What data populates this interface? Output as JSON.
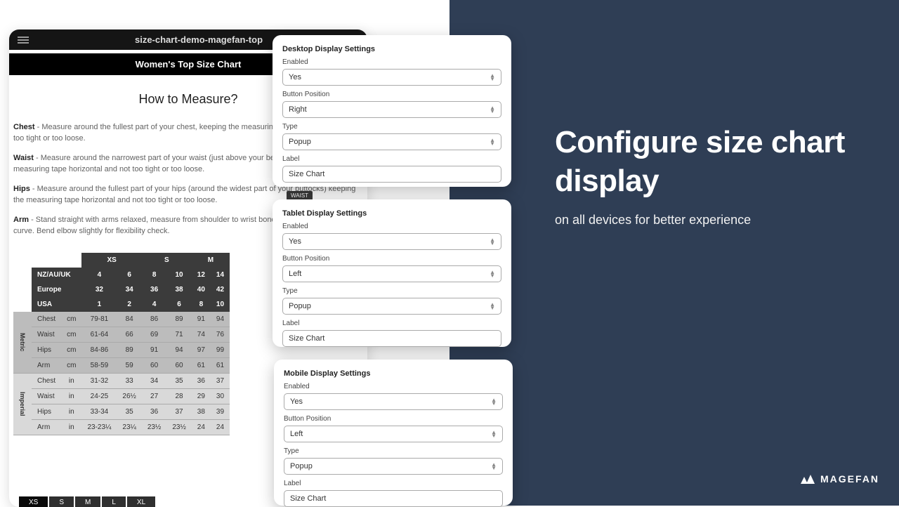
{
  "promo": {
    "headline": "Configure size chart display",
    "sub": "on all devices for better experience"
  },
  "brand": {
    "name": "MAGEFAN"
  },
  "article": {
    "url": "size-chart-demo-magefan-top",
    "title": "Women's Top Size Chart",
    "heading": "How to Measure?",
    "measures": [
      {
        "term": "Chest",
        "text": " - Measure around the fullest part of your chest, keeping the measuring tape horizontal and not too tight or too loose."
      },
      {
        "term": "Waist",
        "text": " - Measure around the narrowest part of your waist (just above your belly button) keeping the measuring tape horizontal and not too tight or too loose."
      },
      {
        "term": "Hips",
        "text": " - Measure around the fullest part of your hips (around the widest part of your buttocks) keeping the measuring tape horizontal and not too tight or too loose."
      },
      {
        "term": "Arm",
        "text": " - Stand straight with arms relaxed, measure from shoulder to wrist bone along arm's natural curve. Bend elbow slightly for flexibility check."
      }
    ],
    "waist_tag": "WAIST",
    "sizes_header": [
      "XS",
      "S",
      "M"
    ],
    "region_rows": [
      {
        "label": "NZ/AU/UK",
        "vals": [
          "4",
          "6",
          "8",
          "10",
          "12",
          "14"
        ]
      },
      {
        "label": "Europe",
        "vals": [
          "32",
          "34",
          "36",
          "38",
          "40",
          "42"
        ]
      },
      {
        "label": "USA",
        "vals": [
          "1",
          "2",
          "4",
          "6",
          "8",
          "10"
        ]
      }
    ],
    "metric_rows": [
      {
        "label": "Chest",
        "unit": "cm",
        "vals": [
          "79-81",
          "84",
          "86",
          "89",
          "91",
          "94"
        ]
      },
      {
        "label": "Waist",
        "unit": "cm",
        "vals": [
          "61-64",
          "66",
          "69",
          "71",
          "74",
          "76"
        ]
      },
      {
        "label": "Hips",
        "unit": "cm",
        "vals": [
          "84-86",
          "89",
          "91",
          "94",
          "97",
          "99"
        ]
      },
      {
        "label": "Arm",
        "unit": "cm",
        "vals": [
          "58-59",
          "59",
          "60",
          "60",
          "61",
          "61"
        ]
      }
    ],
    "imperial_rows": [
      {
        "label": "Chest",
        "unit": "in",
        "vals": [
          "31-32",
          "33",
          "34",
          "35",
          "36",
          "37"
        ]
      },
      {
        "label": "Waist",
        "unit": "in",
        "vals": [
          "24-25",
          "26½",
          "27",
          "28",
          "29",
          "30"
        ]
      },
      {
        "label": "Hips",
        "unit": "in",
        "vals": [
          "33-34",
          "35",
          "36",
          "37",
          "38",
          "39"
        ]
      },
      {
        "label": "Arm",
        "unit": "in",
        "vals": [
          "23-23¼",
          "23¼",
          "23½",
          "23½",
          "24",
          "24"
        ]
      }
    ],
    "side_labels": {
      "metric": "Metric",
      "imperial": "Imperial"
    },
    "bottom_sizes": [
      "XS",
      "S",
      "M",
      "L",
      "XL"
    ]
  },
  "panels": {
    "desktop": {
      "title": "Desktop Display Settings",
      "enabled_label": "Enabled",
      "enabled_value": "Yes",
      "btnpos_label": "Button Position",
      "btnpos_value": "Right",
      "type_label": "Type",
      "type_value": "Popup",
      "label_label": "Label",
      "label_value": "Size Chart"
    },
    "tablet": {
      "title": "Tablet Display Settings",
      "enabled_label": "Enabled",
      "enabled_value": "Yes",
      "btnpos_label": "Button Position",
      "btnpos_value": "Left",
      "type_label": "Type",
      "type_value": "Popup",
      "label_label": "Label",
      "label_value": "Size Chart"
    },
    "mobile": {
      "title": "Mobile Display Settings",
      "enabled_label": "Enabled",
      "enabled_value": "Yes",
      "btnpos_label": "Button Position",
      "btnpos_value": "Left",
      "type_label": "Type",
      "type_value": "Popup",
      "label_label": "Label",
      "label_value": "Size Chart"
    }
  }
}
